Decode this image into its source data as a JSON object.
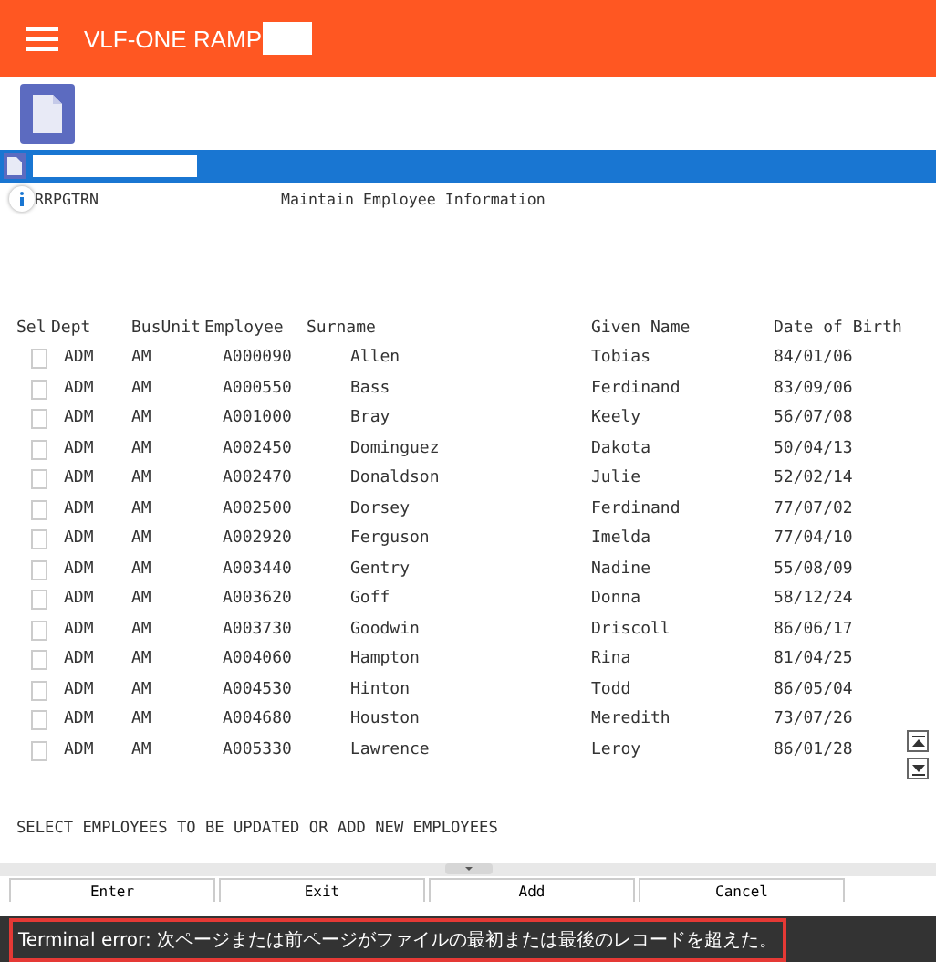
{
  "header": {
    "title": "VLF-ONE RAMP"
  },
  "screen": {
    "program": "RRPGTRN",
    "title": "Maintain Employee Information"
  },
  "table": {
    "columns": [
      "Sel",
      "Dept",
      "BusUnit",
      "Employee",
      "Surname",
      "Given Name",
      "Date of Birth"
    ],
    "rows": [
      {
        "checked": false,
        "dept": "ADM",
        "bus_unit": "AM",
        "employee": "A000090",
        "surname": "Allen",
        "given_name": "Tobias",
        "dob": "84/01/06"
      },
      {
        "checked": false,
        "dept": "ADM",
        "bus_unit": "AM",
        "employee": "A000550",
        "surname": "Bass",
        "given_name": "Ferdinand",
        "dob": "83/09/06"
      },
      {
        "checked": false,
        "dept": "ADM",
        "bus_unit": "AM",
        "employee": "A001000",
        "surname": "Bray",
        "given_name": "Keely",
        "dob": "56/07/08"
      },
      {
        "checked": false,
        "dept": "ADM",
        "bus_unit": "AM",
        "employee": "A002450",
        "surname": "Dominguez",
        "given_name": "Dakota",
        "dob": "50/04/13"
      },
      {
        "checked": false,
        "dept": "ADM",
        "bus_unit": "AM",
        "employee": "A002470",
        "surname": "Donaldson",
        "given_name": "Julie",
        "dob": "52/02/14"
      },
      {
        "checked": false,
        "dept": "ADM",
        "bus_unit": "AM",
        "employee": "A002500",
        "surname": "Dorsey",
        "given_name": "Ferdinand",
        "dob": "77/07/02"
      },
      {
        "checked": false,
        "dept": "ADM",
        "bus_unit": "AM",
        "employee": "A002920",
        "surname": "Ferguson",
        "given_name": "Imelda",
        "dob": "77/04/10"
      },
      {
        "checked": false,
        "dept": "ADM",
        "bus_unit": "AM",
        "employee": "A003440",
        "surname": "Gentry",
        "given_name": "Nadine",
        "dob": "55/08/09"
      },
      {
        "checked": false,
        "dept": "ADM",
        "bus_unit": "AM",
        "employee": "A003620",
        "surname": "Goff",
        "given_name": "Donna",
        "dob": "58/12/24"
      },
      {
        "checked": false,
        "dept": "ADM",
        "bus_unit": "AM",
        "employee": "A003730",
        "surname": "Goodwin",
        "given_name": "Driscoll",
        "dob": "86/06/17"
      },
      {
        "checked": false,
        "dept": "ADM",
        "bus_unit": "AM",
        "employee": "A004060",
        "surname": "Hampton",
        "given_name": "Rina",
        "dob": "81/04/25"
      },
      {
        "checked": false,
        "dept": "ADM",
        "bus_unit": "AM",
        "employee": "A004530",
        "surname": "Hinton",
        "given_name": "Todd",
        "dob": "86/05/04"
      },
      {
        "checked": false,
        "dept": "ADM",
        "bus_unit": "AM",
        "employee": "A004680",
        "surname": "Houston",
        "given_name": "Meredith",
        "dob": "73/07/26"
      },
      {
        "checked": false,
        "dept": "ADM",
        "bus_unit": "AM",
        "employee": "A005330",
        "surname": "Lawrence",
        "given_name": "Leroy",
        "dob": "86/01/28"
      }
    ]
  },
  "message": "SELECT EMPLOYEES TO BE UPDATED OR ADD NEW EMPLOYEES",
  "buttons": [
    "Enter",
    "Exit",
    "Add",
    "Cancel"
  ],
  "error": "Terminal error: 次ページまたは前ページがファイルの最初または最後のレコードを超えた。"
}
